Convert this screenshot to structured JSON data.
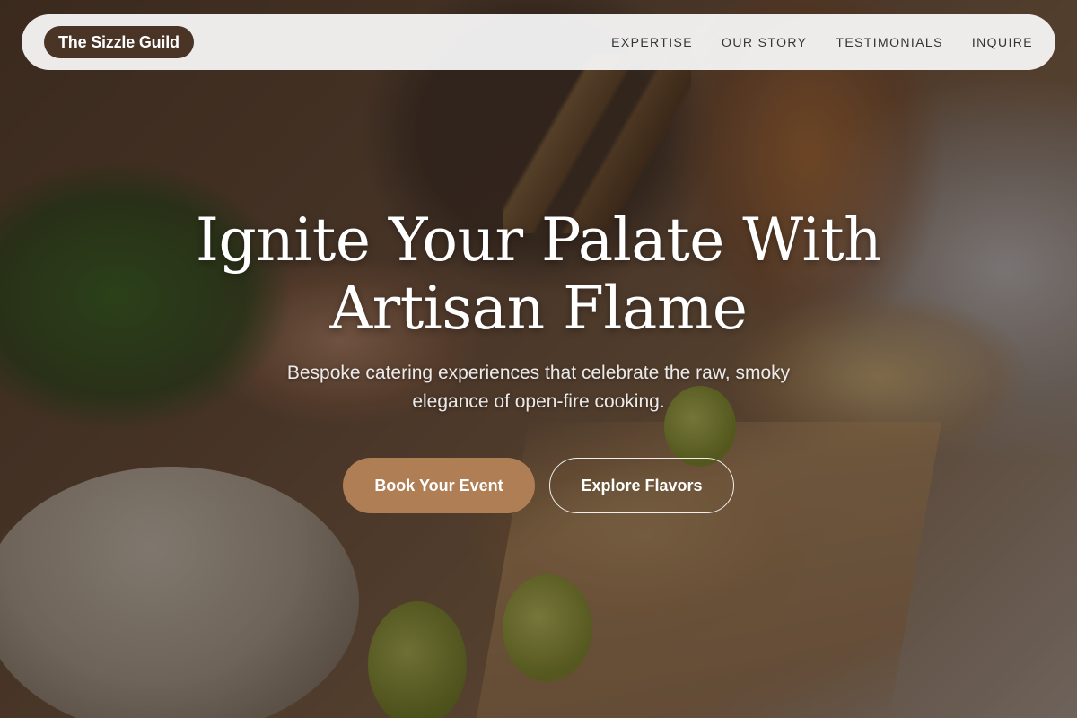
{
  "brand": {
    "name": "The Sizzle Guild"
  },
  "nav": {
    "links": [
      {
        "label": "EXPERTISE"
      },
      {
        "label": "OUR STORY"
      },
      {
        "label": "TESTIMONIALS"
      },
      {
        "label": "INQUIRE"
      }
    ]
  },
  "hero": {
    "headline": "Ignite Your Palate With Artisan Flame",
    "subheadline": "Bespoke catering experiences that celebrate the raw, smoky elegance of open-fire cooking.",
    "primary_cta": "Book Your Event",
    "secondary_cta": "Explore Flavors",
    "background_image": "catering-buffet-photo"
  },
  "colors": {
    "brand_pill": "#4a3426",
    "primary_button": "#b07e55",
    "nav_background": "#fafafa",
    "overlay": "#140c06"
  }
}
